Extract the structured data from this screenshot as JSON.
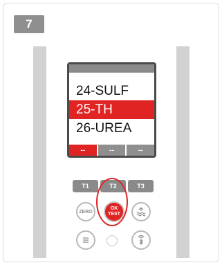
{
  "step": {
    "number": "7"
  },
  "screen": {
    "items": [
      {
        "label": "24-SULF",
        "selected": false
      },
      {
        "label": "25-TH",
        "selected": true
      },
      {
        "label": "26-UREA",
        "selected": false
      }
    ],
    "slots": [
      "--",
      "--",
      "--"
    ],
    "active_slot": 0
  },
  "buttons": {
    "t1": "T1",
    "t2": "T2",
    "t3": "T3",
    "zero": "ZERO",
    "ok_line1": "OK",
    "ok_line2": "TEST"
  },
  "icons": {
    "water": "water-level-icon",
    "menu": "menu-icon",
    "bluetooth": "bluetooth-icon",
    "sensor": "light-sensor-icon"
  },
  "colors": {
    "accent": "#e02424",
    "button_gray": "#8a8a8a",
    "rail_gray": "#d2d2d2"
  }
}
